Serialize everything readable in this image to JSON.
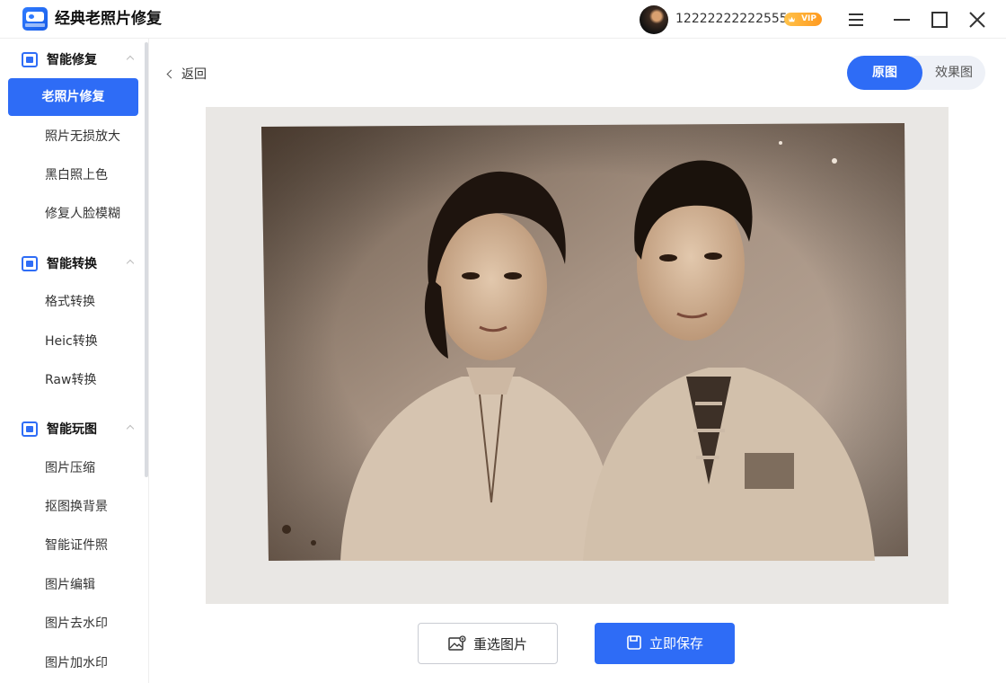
{
  "app": {
    "title": "经典老照片修复"
  },
  "user": {
    "phone": "12222222222555",
    "badge": "VIP"
  },
  "sidebar": {
    "groups": [
      {
        "label": "智能修复",
        "items": [
          "老照片修复",
          "照片无损放大",
          "黑白照上色",
          "修复人脸模糊"
        ]
      },
      {
        "label": "智能转换",
        "items": [
          "格式转换",
          "Heic转换",
          "Raw转换"
        ]
      },
      {
        "label": "智能玩图",
        "items": [
          "图片压缩",
          "抠图换背景",
          "智能证件照",
          "图片编辑",
          "图片去水印",
          "图片加水印"
        ]
      }
    ],
    "active_item": "老照片修复"
  },
  "main": {
    "back_label": "返回",
    "view_toggle": {
      "original": "原图",
      "result": "效果图",
      "selected": "原图"
    },
    "reselect_label": "重选图片",
    "save_label": "立即保存"
  },
  "colors": {
    "accent": "#2e6cf6",
    "vip": "#ffb02e"
  },
  "icons": [
    "app-logo-icon",
    "menu-icon",
    "minimize-icon",
    "maximize-icon",
    "close-icon",
    "chevron-left-icon",
    "image-icon",
    "save-icon"
  ]
}
